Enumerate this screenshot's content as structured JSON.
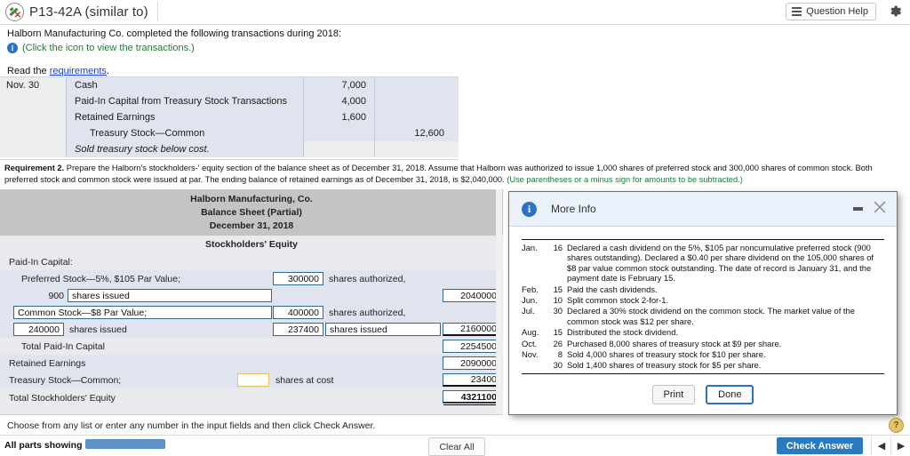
{
  "header": {
    "question_title": "P13-42A (similar to)",
    "help_label": "Question Help",
    "icons": {
      "pencil": "pencil-icon",
      "list": "list-icon",
      "gear": "gear-icon"
    }
  },
  "intro": {
    "line1": "Halborn Manufacturing Co. completed the following transactions during 2018:",
    "icon_hint": "(Click the icon to view the transactions.)",
    "read_prefix": "Read the ",
    "read_link": "requirements",
    "read_suffix": "."
  },
  "journal": {
    "date": "Nov. 30",
    "rows": [
      {
        "account": "Cash",
        "debit": "7,000",
        "credit": "",
        "indent": false,
        "note": false
      },
      {
        "account": "Paid-In Capital from Treasury Stock Transactions",
        "debit": "4,000",
        "credit": "",
        "indent": false,
        "note": false
      },
      {
        "account": "Retained Earnings",
        "debit": "1,600",
        "credit": "",
        "indent": false,
        "note": false
      },
      {
        "account": "Treasury Stock—Common",
        "debit": "",
        "credit": "12,600",
        "indent": true,
        "note": false
      },
      {
        "account": "Sold treasury stock below cost.",
        "debit": "",
        "credit": "",
        "indent": false,
        "note": true
      }
    ]
  },
  "requirement2": {
    "label": "Requirement 2.",
    "text": " Prepare the Halborn's stockholders-' equity section of the balance sheet as of December 31, 2018. Assume that Halborn was authorized to issue 1,000 shares of preferred stock and 300,000 shares of common stock. Both preferred stock and common stock were issued at par. The ending balance of retained earnings as of December 31, 2018, is $2,040,000. ",
    "hint": "(Use parentheses or a minus sign for amounts to be subtracted.)"
  },
  "balance_sheet": {
    "company": "Halborn Manufacturing, Co.",
    "statement": "Balance Sheet (Partial)",
    "date": "December 31, 2018",
    "section": "Stockholders' Equity",
    "paid_in_capital_label": "Paid-In Capital:",
    "rows": {
      "preferred_label": "Preferred Stock—5%, $105 Par Value;",
      "preferred_authorized": "300000",
      "shares_authorized_text": "shares authorized,",
      "preferred_issued_count": "900",
      "preferred_issued_text": "shares issued",
      "preferred_amount": "2040000",
      "common_label": "Common Stock—$8 Par Value;",
      "common_authorized": "400000",
      "common_issued_count": "240000",
      "common_issued_text": "shares issued",
      "common_issued_count2": "237400",
      "common_issued_text2": "shares issued",
      "common_amount": "2160000",
      "total_paid_in_label": "Total Paid-In Capital",
      "total_paid_in_amount": "2254500",
      "retained_label": "Retained Earnings",
      "retained_amount": "2090000",
      "treasury_label": "Treasury Stock—Common;",
      "treasury_shares": "",
      "treasury_shares_text": "shares at cost",
      "treasury_amount": "23400",
      "total_equity_label": "Total Stockholders' Equity",
      "total_equity_amount": "4321100"
    }
  },
  "modal": {
    "title": "More Info",
    "transactions": [
      {
        "month": "Jan.",
        "day": "16",
        "text": "Declared a cash dividend on the 5%, $105 par noncumulative preferred stock (900 shares outstanding). Declared a $0.40 per share dividend on the 105,000 shares of $8 par value common stock outstanding. The date of record is January 31, and the payment date is February 15."
      },
      {
        "month": "Feb.",
        "day": "15",
        "text": "Paid the cash dividends."
      },
      {
        "month": "Jun.",
        "day": "10",
        "text": "Split common stock 2-for-1."
      },
      {
        "month": "Jul.",
        "day": "30",
        "text": "Declared a 30% stock dividend on the common stock. The market value of the common stock was $12 per share."
      },
      {
        "month": "Aug.",
        "day": "15",
        "text": "Distributed the stock dividend."
      },
      {
        "month": "Oct.",
        "day": "26",
        "text": "Purchased 8,000 shares of treasury stock at $9 per share."
      },
      {
        "month": "Nov.",
        "day": "8",
        "text": "Sold 4,000 shares of treasury stock for $10 per share."
      },
      {
        "month": "",
        "day": "30",
        "text": "Sold 1,400 shares of treasury stock for $5 per share."
      }
    ],
    "print_label": "Print",
    "done_label": "Done"
  },
  "footer": {
    "instruction": "Choose from any list or enter any number in the input fields and then click Check Answer.",
    "all_parts": "All parts showing",
    "clear_all": "Clear All",
    "check_answer": "Check Answer",
    "prev_icon": "◀",
    "next_icon": "▶",
    "help_icon": "?"
  },
  "colors": {
    "accent_blue": "#2a7ac0",
    "link_blue": "#1a3fd0",
    "green": "#1f7a33",
    "input_border": "#2e6b8f",
    "empty_input_border": "#e2c160"
  }
}
